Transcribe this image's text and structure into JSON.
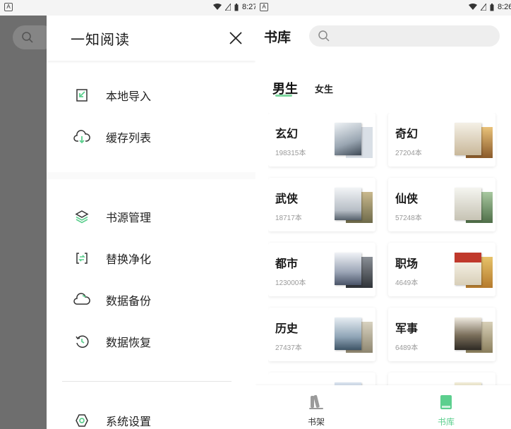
{
  "left_screen": {
    "status": {
      "time": "8:27"
    },
    "drawer": {
      "title": "一知阅读",
      "items": [
        {
          "label": "本地导入",
          "icon": "import-icon"
        },
        {
          "label": "缓存列表",
          "icon": "cloud-download-icon"
        },
        {
          "label": "书源管理",
          "icon": "layers-icon"
        },
        {
          "label": "替换净化",
          "icon": "replace-icon"
        },
        {
          "label": "数据备份",
          "icon": "cloud-icon"
        },
        {
          "label": "数据恢复",
          "icon": "restore-icon"
        },
        {
          "label": "系统设置",
          "icon": "settings-icon"
        }
      ]
    }
  },
  "right_screen": {
    "status": {
      "time": "8:26"
    },
    "header": {
      "title": "书库",
      "search_placeholder": ""
    },
    "tabs": [
      {
        "label": "男生",
        "active": true
      },
      {
        "label": "女生",
        "active": false
      }
    ],
    "categories": [
      {
        "name": "玄幻",
        "count": "198315本"
      },
      {
        "name": "奇幻",
        "count": "27204本"
      },
      {
        "name": "武侠",
        "count": "18717本"
      },
      {
        "name": "仙侠",
        "count": "57248本"
      },
      {
        "name": "都市",
        "count": "123000本"
      },
      {
        "name": "职场",
        "count": "4649本"
      },
      {
        "name": "历史",
        "count": "27437本"
      },
      {
        "name": "军事",
        "count": "6489本"
      }
    ],
    "bottom_nav": [
      {
        "label": "书架",
        "active": false
      },
      {
        "label": "书库",
        "active": true
      }
    ],
    "colors": {
      "accent": "#5ccf8e",
      "tab_underline": "#7fd8a0"
    }
  }
}
